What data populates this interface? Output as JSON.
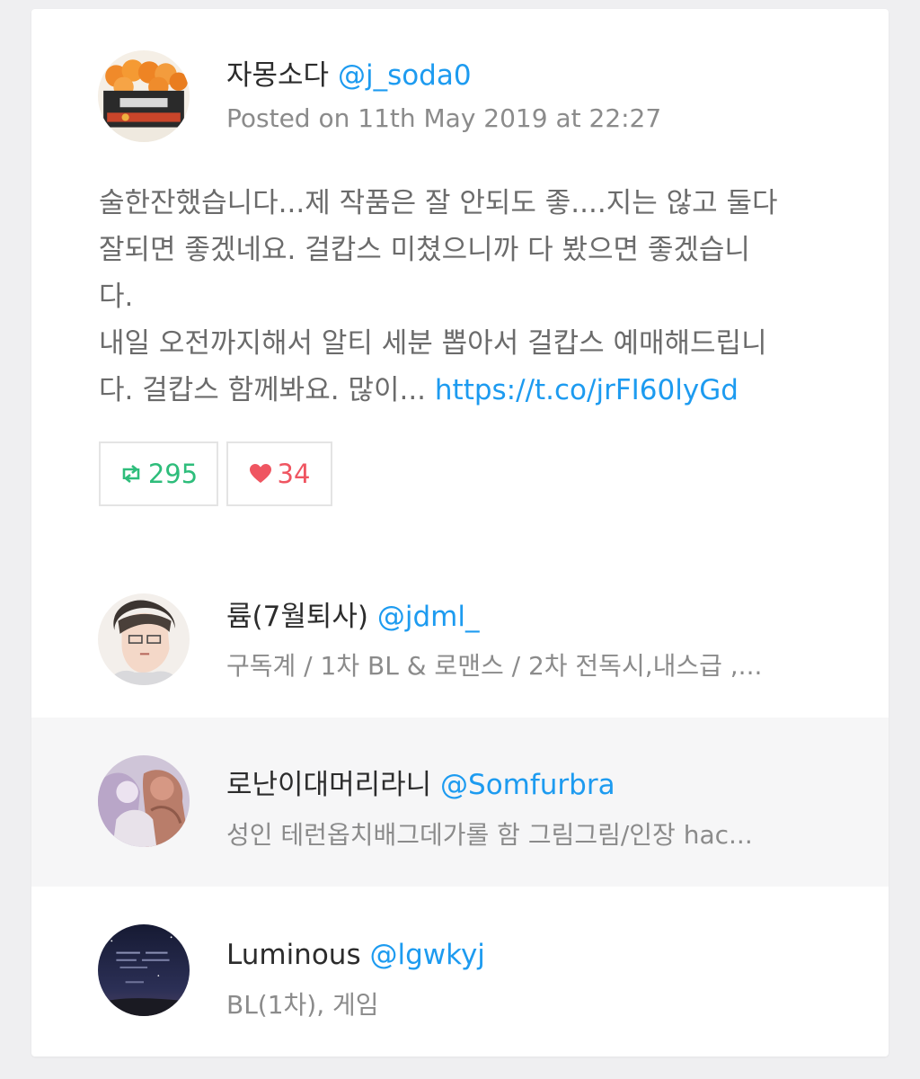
{
  "tweet": {
    "author_name": "자몽소다",
    "author_handle": "@j_soda0",
    "posted": "Posted on 11th May 2019 at 22:27",
    "text": "술한잔했습니다...제 작품은 잘 안되도 좋....지는 않고 둘다\n잘되면 좋겠네요. 걸캅스 미쳤으니까 다 봤으면 좋겠습니\n다.\n내일 오전까지해서 알티 세분 뽑아서 걸캅스 예매해드립니\n다. 걸캅스 함께봐요. 많이... ",
    "link": "https://t.co/jrFI60lyGd",
    "retweets": "295",
    "likes": "34"
  },
  "users": [
    {
      "name": "륨(7월퇴사)",
      "handle": "@jdml_",
      "bio": "구독계 / 1차 BL & 로맨스 / 2차 전독시,내스급 ,..."
    },
    {
      "name": "로난이대머리라니",
      "handle": "@Somfurbra",
      "bio": "성인 테런옵치배그데가롤 함 그림그림/인장 hac..."
    },
    {
      "name": "Luminous",
      "handle": "@lgwkyj",
      "bio": "BL(1차), 게임"
    }
  ],
  "icons": {
    "retweet": "retweet-icon",
    "like": "heart-icon"
  },
  "colors": {
    "handle": "#1d9bf0",
    "retweet": "#2ebd7b",
    "like": "#ef5561",
    "alt_row": "#f6f6f7"
  }
}
